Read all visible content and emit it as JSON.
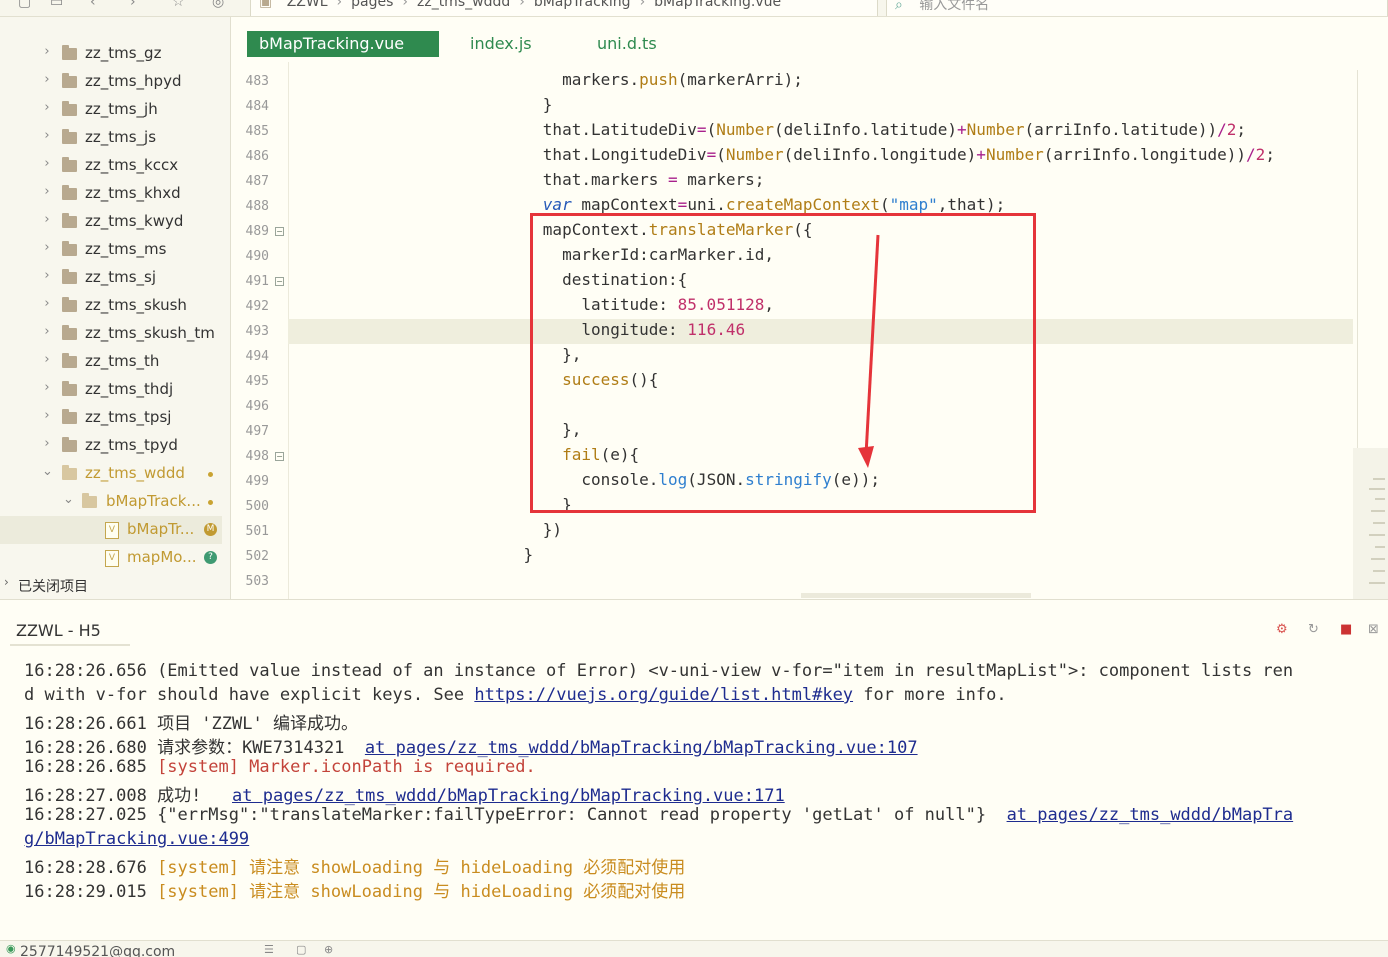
{
  "topbar": {
    "breadcrumb": [
      "ZZWL",
      "pages",
      "zz_tms_wddd",
      "bMapTracking",
      "bMapTracking.vue"
    ],
    "search_placeholder": "输入文件名"
  },
  "sidebar": {
    "items": [
      {
        "label": "zz_tms_gz"
      },
      {
        "label": "zz_tms_hpyd"
      },
      {
        "label": "zz_tms_jh"
      },
      {
        "label": "zz_tms_js"
      },
      {
        "label": "zz_tms_kccx"
      },
      {
        "label": "zz_tms_khxd"
      },
      {
        "label": "zz_tms_kwyd"
      },
      {
        "label": "zz_tms_ms"
      },
      {
        "label": "zz_tms_sj"
      },
      {
        "label": "zz_tms_skush"
      },
      {
        "label": "zz_tms_skush_tm"
      },
      {
        "label": "zz_tms_th"
      },
      {
        "label": "zz_tms_thdj"
      },
      {
        "label": "zz_tms_tpsj"
      },
      {
        "label": "zz_tms_tpyd"
      },
      {
        "label": "zz_tms_wddd"
      },
      {
        "label": "bMapTrack..."
      },
      {
        "label": "bMapTr...",
        "badge": "M"
      },
      {
        "label": "mapMo...",
        "badge": "?"
      }
    ],
    "closed_projects": "已关闭项目"
  },
  "tabs": [
    {
      "label": "bMapTracking.vue"
    },
    {
      "label": "index.js"
    },
    {
      "label": "uni.d.ts"
    }
  ],
  "editor": {
    "line_numbers": [
      "483",
      "484",
      "485",
      "486",
      "487",
      "488",
      "489",
      "490",
      "491",
      "492",
      "493",
      "494",
      "495",
      "496",
      "497",
      "498",
      "499",
      "500",
      "501",
      "502",
      "503"
    ]
  },
  "console": {
    "title": "ZZWL - H5",
    "lines": {
      "l1_ts": "16:28:26.656",
      "l1_text": " (Emitted value instead of an instance of Error) <v-uni-view v-for=\"item in resultMapList\">: component lists ren",
      "l2_text": "d with v-for should have explicit keys. See ",
      "l2_link": "https://vuejs.org/guide/list.html#key",
      "l2_tail": " for more info.",
      "l3_ts": "16:28:26.661",
      "l3_text": " 项目 'ZZWL' 编译成功。",
      "l4_ts": "16:28:26.680",
      "l4_text": " 请求参数：KWE7314321  ",
      "l4_link": "at pages/zz_tms_wddd/bMapTracking/bMapTracking.vue:107",
      "l5_ts": "16:28:26.685",
      "l5_text": " [system] Marker.iconPath is required.",
      "l6_ts": "16:28:27.008",
      "l6_text": " 成功!   ",
      "l6_link": "at pages/zz_tms_wddd/bMapTracking/bMapTracking.vue:171",
      "l7_ts": "16:28:27.025",
      "l7_text": " {\"errMsg\":\"translateMarker:failTypeError: Cannot read property 'getLat' of null\"}  ",
      "l7_link": "at pages/zz_tms_wddd/bMapTra",
      "l8_link": "g/bMapTracking.vue:499",
      "l9_ts": "16:28:28.676",
      "l9_text": " [system] 请注意 showLoading 与 hideLoading 必须配对使用",
      "l10_ts": "16:28:29.015",
      "l10_text": " [system] 请注意 showLoading 与 hideLoading 必须配对使用"
    }
  },
  "statusbar": {
    "user": "2577149521@qq.com"
  },
  "colors": {
    "accent": "#2f8a4f",
    "annotation_red": "#e5343a",
    "link": "#1e2c8f",
    "error": "#c3433a",
    "warning": "#c98c1f"
  }
}
